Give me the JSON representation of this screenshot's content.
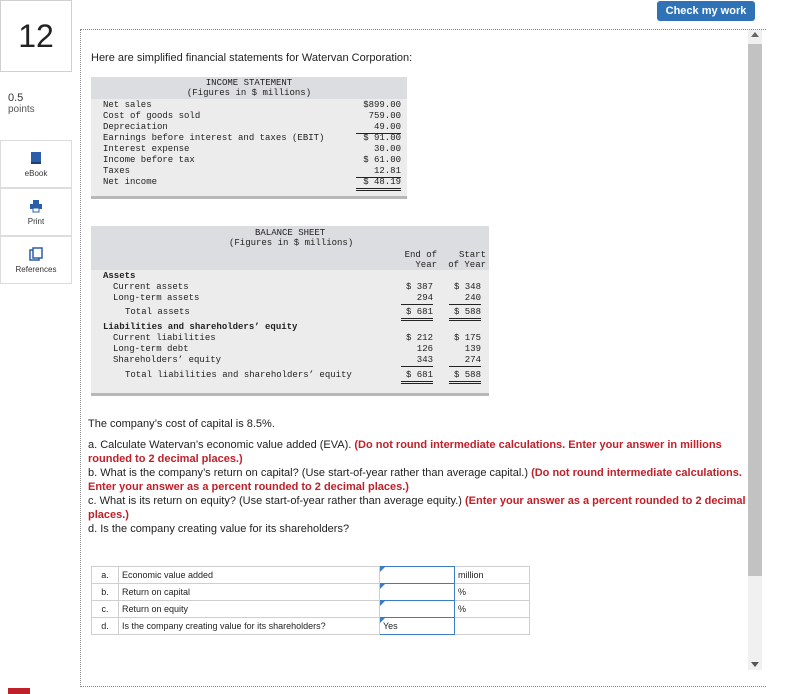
{
  "question": {
    "number": "12",
    "points": "0.5",
    "points_label": "points"
  },
  "tools": [
    {
      "label": "eBook",
      "icon": "ebook-icon"
    },
    {
      "label": "Print",
      "icon": "print-icon"
    },
    {
      "label": "References",
      "icon": "references-icon"
    }
  ],
  "check_button": "Check my work",
  "intro": "Here are simplified financial statements for Watervan Corporation:",
  "income": {
    "title": "INCOME STATEMENT",
    "subtitle": "(Figures in $ millions)",
    "rows": [
      {
        "label": "Net sales",
        "value": "$899.00"
      },
      {
        "label": "Cost of goods sold",
        "value": "759.00"
      },
      {
        "label": "Depreciation",
        "value": "49.00"
      },
      {
        "label": "Earnings before interest and taxes (EBIT)",
        "value": "$ 91.00"
      },
      {
        "label": "Interest expense",
        "value": "30.00"
      },
      {
        "label": "Income before tax",
        "value": "$ 61.00"
      },
      {
        "label": "Taxes",
        "value": "12.81"
      },
      {
        "label": "Net income",
        "value": "$ 48.19"
      }
    ]
  },
  "balance": {
    "title": "BALANCE SHEET",
    "subtitle": "(Figures in $ millions)",
    "col1a": "End of",
    "col1b": "Year",
    "col2a": "Start",
    "col2b": "of Year",
    "assets_label": "Assets",
    "rows": [
      {
        "label": "Current assets",
        "end": "$ 387",
        "start": "$ 348"
      },
      {
        "label": "Long-term assets",
        "end": "294",
        "start": "240"
      },
      {
        "label": "Total assets",
        "end": "$ 681",
        "start": "$ 588"
      },
      {
        "label": "Current liabilities",
        "end": "$ 212",
        "start": "$ 175"
      },
      {
        "label": "Long-term debt",
        "end": "126",
        "start": "139"
      },
      {
        "label": "Shareholders’ equity",
        "end": "343",
        "start": "274"
      },
      {
        "label": "Total liabilities and shareholders’ equity",
        "end": "$ 681",
        "start": "$ 588"
      }
    ],
    "liab_label": "Liabilities and shareholders’ equity"
  },
  "cost_of_capital": "The company’s cost of capital is 8.5%.",
  "parts": {
    "a_text": "a. Calculate Watervan’s economic value added (EVA). ",
    "a_red": "(Do not round intermediate calculations. Enter your answer in millions rounded to 2 decimal places.)",
    "b_text": "b. What is the company’s return on capital? (Use start-of-year rather than average capital.) ",
    "b_red": "(Do not round intermediate calculations. Enter your answer as a percent rounded to 2 decimal places.)",
    "c_text": "c. What is its return on equity? (Use start-of-year rather than average equity.) ",
    "c_red": "(Enter your answer as a percent rounded to 2 decimal places.)",
    "d_text": "d. Is the company creating value for its shareholders?"
  },
  "answers": [
    {
      "letter": "a.",
      "label": "Economic value added",
      "value": "",
      "unit": "million"
    },
    {
      "letter": "b.",
      "label": "Return on capital",
      "value": "",
      "unit": "%"
    },
    {
      "letter": "c.",
      "label": "Return on equity",
      "value": "",
      "unit": "%"
    },
    {
      "letter": "d.",
      "label": "Is the company creating value for its shareholders?",
      "value": "Yes",
      "unit": ""
    }
  ]
}
